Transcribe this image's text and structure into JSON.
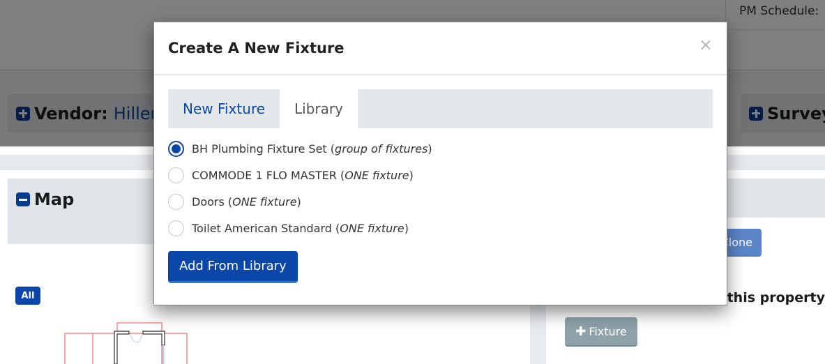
{
  "page": {
    "pm_schedule_label": "PM Schedule:",
    "vendor_label": "Vendor:",
    "vendor_value": "Hiller",
    "survey_label": "Survey",
    "map_label": "Map",
    "all_badge": "All",
    "clone_label": "Clone",
    "property_text": "this property",
    "add_fixture_label": "Fixture",
    "icons": {
      "vendor": "plus-square-icon",
      "survey": "plus-square-icon",
      "map": "minus-square-icon",
      "fixture": "plus-icon"
    }
  },
  "modal": {
    "title": "Create A New Fixture",
    "close_glyph": "×",
    "tabs": [
      {
        "label": "New Fixture",
        "active": false
      },
      {
        "label": "Library",
        "active": true
      }
    ],
    "options": [
      {
        "name": "BH Plumbing Fixture Set",
        "type": "group of fixtures",
        "selected": true
      },
      {
        "name": "COMMODE 1 FLO MASTER",
        "type": "ONE fixture",
        "selected": false
      },
      {
        "name": "Doors",
        "type": "ONE fixture",
        "selected": false
      },
      {
        "name": "Toilet American Standard",
        "type": "ONE fixture",
        "selected": false
      }
    ],
    "submit_label": "Add From Library"
  },
  "colors": {
    "primary": "#0a47a9",
    "link": "#0d47a1",
    "panel": "#e1e5e9",
    "secondary_button": "#8ea2aa"
  }
}
